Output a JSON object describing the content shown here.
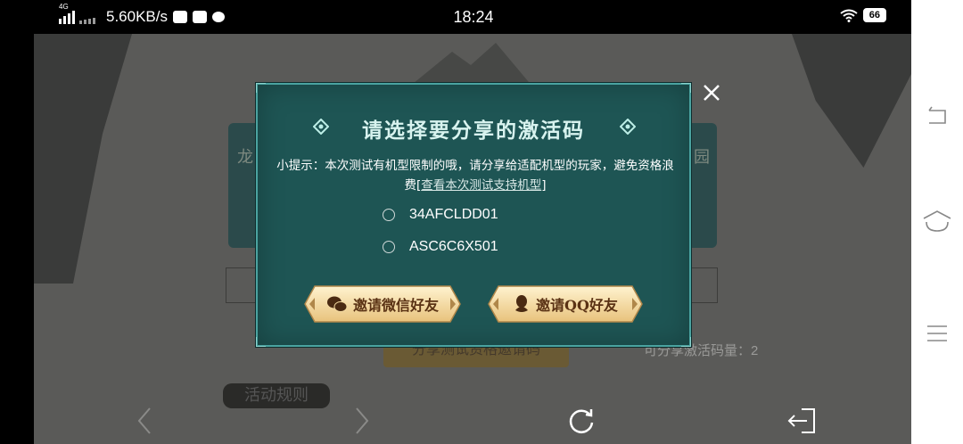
{
  "status_bar": {
    "network_type": "4G",
    "speed": "5.60KB/s",
    "time": "18:24",
    "battery": "66"
  },
  "background": {
    "side_left": "龙",
    "side_right": "园",
    "share_count": "可分享激活码量：2",
    "share_button": "分享测试资格邀请码",
    "rules_title": "活动规则"
  },
  "dialog": {
    "title": "请选择要分享的激活码",
    "hint_text": "小提示：本次测试有机型限制的哦，请分享给适配机型的玩家，避免资格浪费",
    "hint_link_open": "[",
    "hint_link": "查看本次测试支持机型",
    "hint_link_close": "]",
    "codes": [
      {
        "code": "34AFCLDD01",
        "selected": false
      },
      {
        "code": "ASC6C6X501",
        "selected": false
      }
    ],
    "buttons": {
      "wechat": "邀请微信好友",
      "qq": "邀请QQ好友"
    }
  },
  "colors": {
    "dialog_bg": "#1e5554",
    "dialog_border": "#4aa3a0",
    "button_gold": "#f3d9a0",
    "button_text": "#5a3214"
  }
}
